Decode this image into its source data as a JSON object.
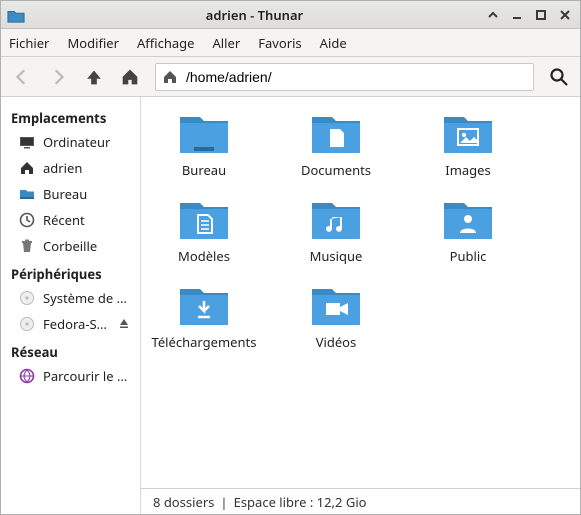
{
  "window": {
    "title": "adrien - Thunar"
  },
  "menu": {
    "items": [
      "Fichier",
      "Modifier",
      "Affichage",
      "Aller",
      "Favoris",
      "Aide"
    ]
  },
  "toolbar": {
    "path": "/home/adrien/"
  },
  "sidebar": {
    "sections": [
      {
        "label": "Emplacements",
        "items": [
          {
            "icon": "computer",
            "label": "Ordinateur"
          },
          {
            "icon": "home",
            "label": "adrien"
          },
          {
            "icon": "desktop",
            "label": "Bureau"
          },
          {
            "icon": "recent",
            "label": "Récent"
          },
          {
            "icon": "trash",
            "label": "Corbeille"
          }
        ]
      },
      {
        "label": "Périphériques",
        "items": [
          {
            "icon": "disk",
            "label": "Système de …"
          },
          {
            "icon": "disk",
            "label": "Fedora-S-…",
            "eject": true
          }
        ]
      },
      {
        "label": "Réseau",
        "items": [
          {
            "icon": "network",
            "label": "Parcourir le …"
          }
        ]
      }
    ]
  },
  "folders": [
    {
      "type": "desktop",
      "label": "Bureau"
    },
    {
      "type": "document",
      "label": "Documents"
    },
    {
      "type": "image",
      "label": "Images"
    },
    {
      "type": "template",
      "label": "Modèles"
    },
    {
      "type": "music",
      "label": "Musique"
    },
    {
      "type": "public",
      "label": "Public"
    },
    {
      "type": "download",
      "label": "Téléchargements"
    },
    {
      "type": "video",
      "label": "Vidéos"
    }
  ],
  "statusbar": {
    "count": "8 dossiers",
    "sep": "|",
    "free": "Espace libre : 12,2 Gio"
  }
}
